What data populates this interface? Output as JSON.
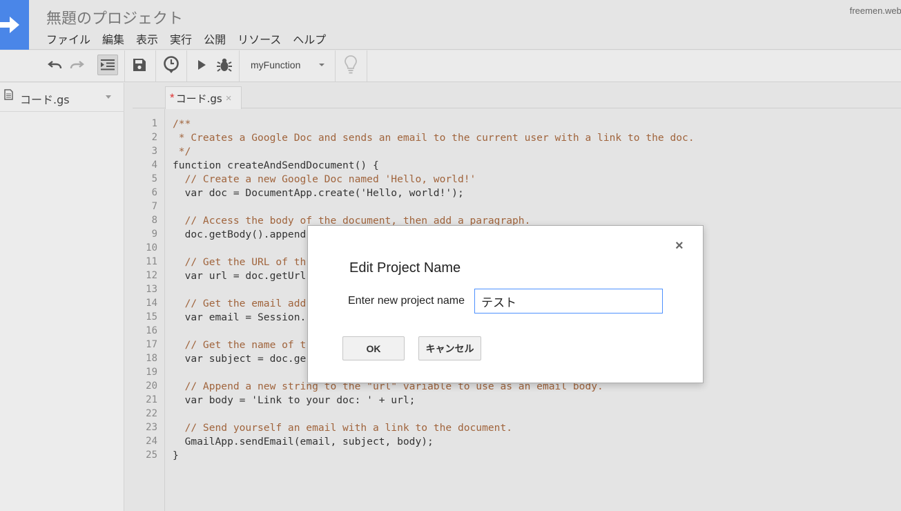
{
  "header": {
    "project_title": "無題のプロジェクト",
    "user": "freemen.webn"
  },
  "menu": [
    "ファイル",
    "編集",
    "表示",
    "実行",
    "公開",
    "リソース",
    "ヘルプ"
  ],
  "toolbar": {
    "function_select": "myFunction",
    "icons": [
      "undo-icon",
      "redo-icon",
      "indent-icon",
      "save-icon",
      "trigger-clock-icon",
      "run-icon",
      "debug-bug-icon",
      "lightbulb-icon"
    ]
  },
  "sidebar": {
    "file_name": "コード.gs"
  },
  "tab": {
    "modified_mark": "*",
    "label": "コード.gs",
    "close": "×"
  },
  "code": {
    "line_numbers": [
      "1",
      "2",
      "3",
      "4",
      "5",
      "6",
      "7",
      "8",
      "9",
      "10",
      "11",
      "12",
      "13",
      "14",
      "15",
      "16",
      "17",
      "18",
      "19",
      "20",
      "21",
      "22",
      "23",
      "24",
      "25"
    ],
    "lines": [
      "/**",
      " * Creates a Google Doc and sends an email to the current user with a link to the doc.",
      " */",
      "function createAndSendDocument() {",
      "  // Create a new Google Doc named 'Hello, world!'",
      "  var doc = DocumentApp.create('Hello, world!');",
      "",
      "  // Access the body of the document, then add a paragraph.",
      "  doc.getBody().append",
      "",
      "  // Get the URL of th",
      "  var url = doc.getUrl",
      "",
      "  // Get the email add",
      "  var email = Session.",
      "",
      "  // Get the name of t",
      "  var subject = doc.ge",
      "",
      "  // Append a new string to the \"url\" variable to use as an email body.",
      "  var body = 'Link to your doc: ' + url;",
      "",
      "  // Send yourself an email with a link to the document.",
      "  GmailApp.sendEmail(email, subject, body);",
      "}"
    ]
  },
  "dialog": {
    "title": "Edit Project Name",
    "field_label": "Enter new project name",
    "input_value": "テスト",
    "ok_label": "OK",
    "cancel_label": "キャンセル",
    "close_label": "×"
  },
  "colors": {
    "brand_blue": "#4a86e8",
    "comment": "#a0643c",
    "keyword": "#7a2aa3",
    "variable": "#2b5faa",
    "input_focus": "#4d90fe"
  }
}
